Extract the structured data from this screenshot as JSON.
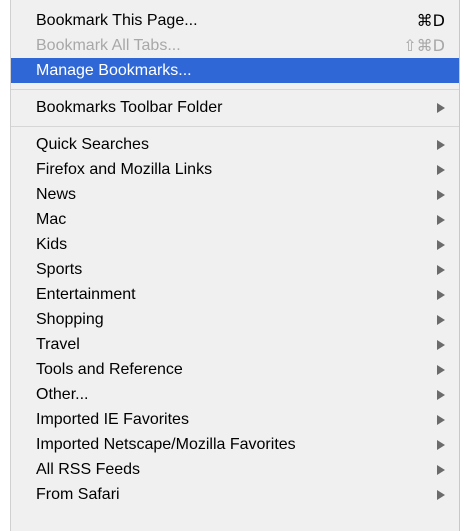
{
  "menu": {
    "top_items": [
      {
        "label": "Bookmark This Page...",
        "shortcut": "⌘D",
        "state": "normal"
      },
      {
        "label": "Bookmark All Tabs...",
        "shortcut": "⇧⌘D",
        "state": "disabled"
      },
      {
        "label": "Manage Bookmarks...",
        "shortcut": "",
        "state": "selected"
      }
    ],
    "toolbar_folder": {
      "label": "Bookmarks Toolbar Folder",
      "has_submenu": true
    },
    "folders": [
      {
        "label": "Quick Searches"
      },
      {
        "label": "Firefox and Mozilla Links"
      },
      {
        "label": "News"
      },
      {
        "label": "Mac"
      },
      {
        "label": "Kids"
      },
      {
        "label": "Sports"
      },
      {
        "label": "Entertainment"
      },
      {
        "label": "Shopping"
      },
      {
        "label": "Travel"
      },
      {
        "label": "Tools and Reference"
      },
      {
        "label": "Other..."
      },
      {
        "label": "Imported IE Favorites"
      },
      {
        "label": "Imported Netscape/Mozilla Favorites"
      },
      {
        "label": "All RSS Feeds"
      },
      {
        "label": "From Safari"
      }
    ],
    "submenu_icon": "right-triangle-icon",
    "colors": {
      "menu_background": "#f0f0f0",
      "selection": "#2f68d6",
      "disabled_text": "#a8a8a8",
      "separator": "#d6d6d6"
    }
  }
}
